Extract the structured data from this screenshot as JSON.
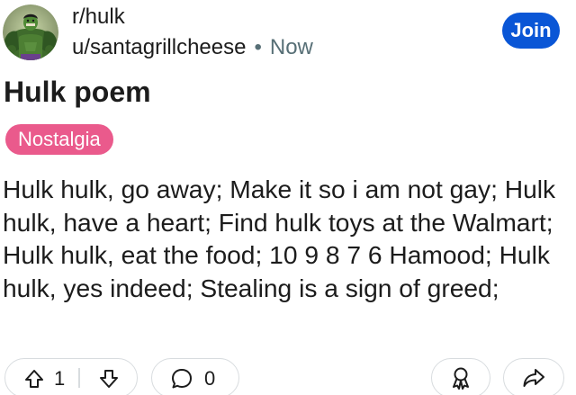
{
  "header": {
    "community": "r/hulk",
    "username": "u/santagrillcheese",
    "separator": "•",
    "time": "Now",
    "join_label": "Join"
  },
  "post": {
    "title": "Hulk poem",
    "flair": "Nostalgia",
    "body": "Hulk hulk, go away; Make it so i am not gay; Hulk hulk, have a heart; Find hulk toys at the Walmart; Hulk hulk, eat the food; 10 9 8 7 6 Hamood; Hulk hulk, yes indeed; Stealing is a sign of greed;"
  },
  "actions": {
    "vote_count": "1",
    "comment_count": "0"
  },
  "colors": {
    "join_bg": "#0a56d6",
    "flair_bg": "#ea5a8c",
    "meta_gray": "#576f76",
    "border": "#d8dcdf"
  },
  "icons": {
    "avatar": "hulk-avatar",
    "upvote": "upvote-arrow-icon",
    "downvote": "downvote-arrow-icon",
    "comment": "comment-bubble-icon",
    "award": "award-icon",
    "share": "share-icon"
  }
}
